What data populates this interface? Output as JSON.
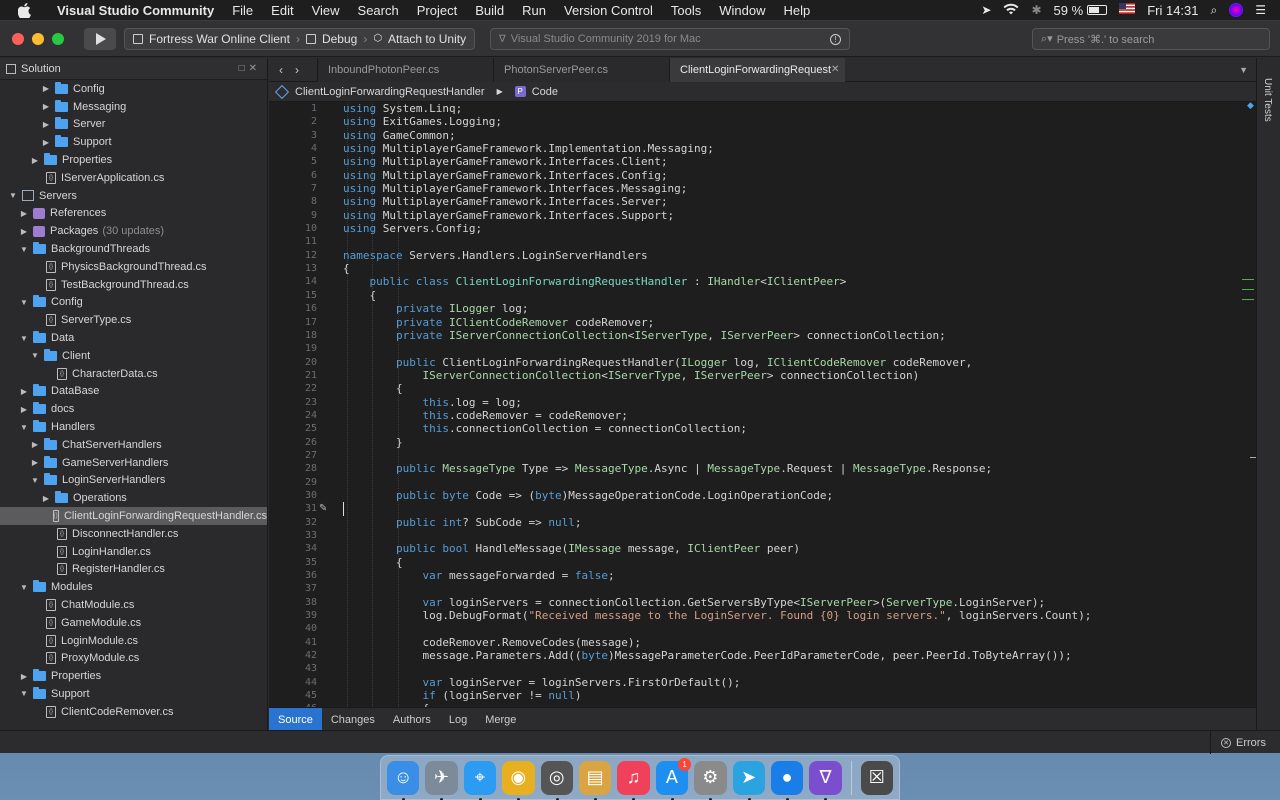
{
  "menubar": {
    "app_name": "Visual Studio Community",
    "items": [
      "File",
      "Edit",
      "View",
      "Search",
      "Project",
      "Build",
      "Run",
      "Version Control",
      "Tools",
      "Window",
      "Help"
    ],
    "battery": "59 %",
    "battery_level": 0.59,
    "clock": "Fri 14:31"
  },
  "toolbar": {
    "project": "Fortress War Online Client",
    "configuration": "Debug",
    "target": "Attach to Unity",
    "status_text": "Visual Studio Community 2019 for Mac",
    "search_placeholder": "Press '⌘.' to search"
  },
  "sidebar": {
    "title": "Solution",
    "rows": [
      {
        "label": "Config",
        "type": "folder",
        "level": 3,
        "arrow": "▶"
      },
      {
        "label": "Messaging",
        "type": "folder",
        "level": 3,
        "arrow": "▶"
      },
      {
        "label": "Server",
        "type": "folder",
        "level": 3,
        "arrow": "▶"
      },
      {
        "label": "Support",
        "type": "folder",
        "level": 3,
        "arrow": "▶"
      },
      {
        "label": "Properties",
        "type": "folder",
        "level": 2,
        "arrow": "▶"
      },
      {
        "label": "IServerApplication.cs",
        "type": "file",
        "level": 2,
        "arrow": ""
      },
      {
        "label": "Servers",
        "type": "project",
        "level": 0,
        "arrow": "▼"
      },
      {
        "label": "References",
        "type": "ref",
        "level": 1,
        "arrow": "▶"
      },
      {
        "label": "Packages",
        "type": "pkg",
        "level": 1,
        "arrow": "▶",
        "extra": "(30 updates)"
      },
      {
        "label": "BackgroundThreads",
        "type": "folder",
        "level": 1,
        "arrow": "▼"
      },
      {
        "label": "PhysicsBackgroundThread.cs",
        "type": "file",
        "level": 2,
        "arrow": ""
      },
      {
        "label": "TestBackgroundThread.cs",
        "type": "file",
        "level": 2,
        "arrow": ""
      },
      {
        "label": "Config",
        "type": "folder",
        "level": 1,
        "arrow": "▼"
      },
      {
        "label": "ServerType.cs",
        "type": "file",
        "level": 2,
        "arrow": ""
      },
      {
        "label": "Data",
        "type": "folder",
        "level": 1,
        "arrow": "▼"
      },
      {
        "label": "Client",
        "type": "folder",
        "level": 2,
        "arrow": "▼"
      },
      {
        "label": "CharacterData.cs",
        "type": "file",
        "level": 3,
        "arrow": ""
      },
      {
        "label": "DataBase",
        "type": "folder",
        "level": 1,
        "arrow": "▶"
      },
      {
        "label": "docs",
        "type": "folder",
        "level": 1,
        "arrow": "▶"
      },
      {
        "label": "Handlers",
        "type": "folder",
        "level": 1,
        "arrow": "▼"
      },
      {
        "label": "ChatServerHandlers",
        "type": "folder",
        "level": 2,
        "arrow": "▶"
      },
      {
        "label": "GameServerHandlers",
        "type": "folder",
        "level": 2,
        "arrow": "▶"
      },
      {
        "label": "LoginServerHandlers",
        "type": "folder",
        "level": 2,
        "arrow": "▼"
      },
      {
        "label": "Operations",
        "type": "folder",
        "level": 3,
        "arrow": "▶"
      },
      {
        "label": "ClientLoginForwardingRequestHandler.cs",
        "type": "file",
        "level": 3,
        "arrow": "",
        "selected": true
      },
      {
        "label": "DisconnectHandler.cs",
        "type": "file",
        "level": 3,
        "arrow": ""
      },
      {
        "label": "LoginHandler.cs",
        "type": "file",
        "level": 3,
        "arrow": ""
      },
      {
        "label": "RegisterHandler.cs",
        "type": "file",
        "level": 3,
        "arrow": ""
      },
      {
        "label": "Modules",
        "type": "folder",
        "level": 1,
        "arrow": "▼"
      },
      {
        "label": "ChatModule.cs",
        "type": "file",
        "level": 2,
        "arrow": ""
      },
      {
        "label": "GameModule.cs",
        "type": "file",
        "level": 2,
        "arrow": ""
      },
      {
        "label": "LoginModule.cs",
        "type": "file",
        "level": 2,
        "arrow": ""
      },
      {
        "label": "ProxyModule.cs",
        "type": "file",
        "level": 2,
        "arrow": ""
      },
      {
        "label": "Properties",
        "type": "folder",
        "level": 1,
        "arrow": "▶"
      },
      {
        "label": "Support",
        "type": "folder",
        "level": 1,
        "arrow": "▼"
      },
      {
        "label": "ClientCodeRemover.cs",
        "type": "file",
        "level": 2,
        "arrow": ""
      }
    ]
  },
  "editor": {
    "tabs": [
      {
        "label": "InboundPhotonPeer.cs",
        "active": false
      },
      {
        "label": "PhotonServerPeer.cs",
        "active": false
      },
      {
        "label": "ClientLoginForwardingRequest",
        "active": true
      }
    ],
    "breadcrumb_class": "ClientLoginForwardingRequestHandler",
    "breadcrumb_member": "Code",
    "cursor_line": 31,
    "lines": [
      "using System.Linq;",
      "using ExitGames.Logging;",
      "using GameCommon;",
      "using MultiplayerGameFramework.Implementation.Messaging;",
      "using MultiplayerGameFramework.Interfaces.Client;",
      "using MultiplayerGameFramework.Interfaces.Config;",
      "using MultiplayerGameFramework.Interfaces.Messaging;",
      "using MultiplayerGameFramework.Interfaces.Server;",
      "using MultiplayerGameFramework.Interfaces.Support;",
      "using Servers.Config;",
      "",
      "namespace Servers.Handlers.LoginServerHandlers",
      "{",
      "    public class ClientLoginForwardingRequestHandler : IHandler<IClientPeer>",
      "    {",
      "        private ILogger log;",
      "        private IClientCodeRemover codeRemover;",
      "        private IServerConnectionCollection<IServerType, IServerPeer> connectionCollection;",
      "",
      "        public ClientLoginForwardingRequestHandler(ILogger log, IClientCodeRemover codeRemover,",
      "            IServerConnectionCollection<IServerType, IServerPeer> connectionCollection)",
      "        {",
      "            this.log = log;",
      "            this.codeRemover = codeRemover;",
      "            this.connectionCollection = connectionCollection;",
      "        }",
      "",
      "        public MessageType Type => MessageType.Async | MessageType.Request | MessageType.Response;",
      "",
      "        public byte Code => (byte)MessageOperationCode.LoginOperationCode;",
      "",
      "        public int? SubCode => null;",
      "",
      "        public bool HandleMessage(IMessage message, IClientPeer peer)",
      "        {",
      "            var messageForwarded = false;",
      "",
      "            var loginServers = connectionCollection.GetServersByType<IServerPeer>(ServerType.LoginServer);",
      "            log.DebugFormat(\"Received message to the LoginServer. Found {0} login servers.\", loginServers.Count);",
      "",
      "            codeRemover.RemoveCodes(message);",
      "            message.Parameters.Add((byte)MessageParameterCode.PeerIdParameterCode, peer.PeerId.ToByteArray());",
      "",
      "            var loginServer = loginServers.FirstOrDefault();",
      "            if (loginServer != null)",
      "            {"
    ],
    "bottom_tabs": [
      "Source",
      "Changes",
      "Authors",
      "Log",
      "Merge"
    ]
  },
  "right_rail": {
    "label": "Unit Tests"
  },
  "statusbar": {
    "errors": "Errors"
  },
  "dock": {
    "apps": [
      {
        "name": "finder-icon",
        "color": "#3a8ee6",
        "glyph": "☺"
      },
      {
        "name": "launchpad-icon",
        "color": "#7d8a99",
        "glyph": "✈"
      },
      {
        "name": "safari-icon",
        "color": "#2b9cf2",
        "glyph": "⌖"
      },
      {
        "name": "chrome-icon",
        "color": "#e8b020",
        "glyph": "◉"
      },
      {
        "name": "dvd-player-icon",
        "color": "#555555",
        "glyph": "◎"
      },
      {
        "name": "preview-icon",
        "color": "#d9a441",
        "glyph": "▤"
      },
      {
        "name": "music-icon",
        "color": "#f0405a",
        "glyph": "♫"
      },
      {
        "name": "app-store-icon",
        "color": "#1e8ff0",
        "glyph": "A",
        "badge": "1"
      },
      {
        "name": "system-preferences-icon",
        "color": "#8a8a8a",
        "glyph": "⚙"
      },
      {
        "name": "telegram-icon",
        "color": "#2aa3e0",
        "glyph": "➤"
      },
      {
        "name": "maps-pin-icon",
        "color": "#1a7ee8",
        "glyph": "●"
      },
      {
        "name": "visual-studio-icon",
        "color": "#7b4ecf",
        "glyph": "∇"
      }
    ],
    "trash": {
      "name": "trash-icon",
      "color": "#4a4a4a",
      "glyph": "☒"
    }
  }
}
